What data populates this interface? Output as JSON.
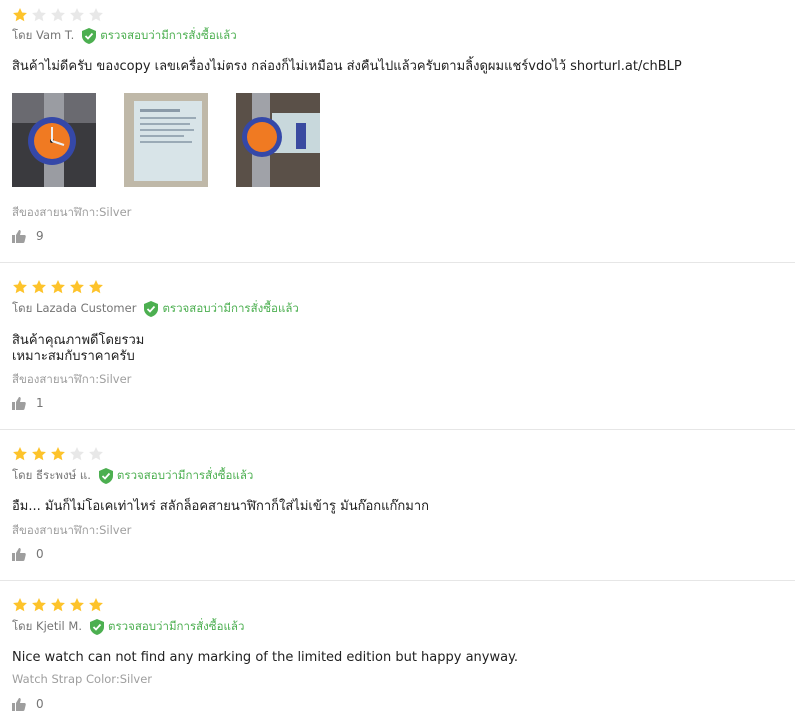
{
  "reviews": [
    {
      "rating": 1,
      "author": "โดย Vam T.",
      "verified_label": "ตรวจสอบว่ามีการสั่งซื้อแล้ว",
      "content": "สินค้าไม่ดีครับ ของcopy เลขเครื่องไม่ตรง กล่องก็ไม่เหมือน ส่งคืนไปแล้วครับตามลิ้งดูผมแชร์vdoไว้ shorturl.at/chBLP",
      "images": [
        "watch-photo-front",
        "warranty-card-photo",
        "watch-with-card-photo"
      ],
      "sku": "สีของสายนาฬิกา:Silver",
      "likes": "9"
    },
    {
      "rating": 5,
      "author": "โดย Lazada Customer",
      "verified_label": "ตรวจสอบว่ามีการสั่งซื้อแล้ว",
      "content": "สินค้าคุณภาพดีโดยรวม\n เหมาะสมกับราคาครับ",
      "sku": "สีของสายนาฬิกา:Silver",
      "likes": "1"
    },
    {
      "rating": 3,
      "author": "โดย ธีระพงษ์ แ.",
      "verified_label": "ตรวจสอบว่ามีการสั่งซื้อแล้ว",
      "content": "อืม... มันก็ไม่โอเคเท่าไหร่ สลักล็อคสายนาฬิกาก็ใส่ไม่เข้ารู มันก๊อกแก๊กมาก",
      "sku": "สีของสายนาฬิกา:Silver",
      "likes": "0"
    },
    {
      "rating": 5,
      "author": "โดย Kjetil M.",
      "verified_label": "ตรวจสอบว่ามีการสั่งซื้อแล้ว",
      "content": "Nice watch can not find any marking of the limited edition but happy anyway.",
      "sku": "Watch Strap Color:Silver",
      "likes": "0"
    }
  ],
  "colors": {
    "star_filled": "#fdc32b",
    "star_empty": "#e8e8e8",
    "verified": "#4caf50"
  }
}
